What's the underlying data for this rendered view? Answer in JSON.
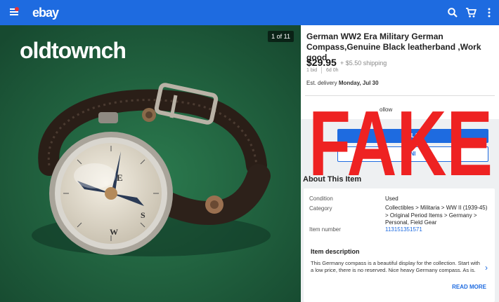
{
  "appbar": {
    "logo": "ebay",
    "icons": [
      "menu-icon",
      "search-icon",
      "cart-icon",
      "more-vert-icon"
    ],
    "brand_color": "#1e6be0",
    "notification_color": "#e53238"
  },
  "gallery": {
    "counter": "1 of 11",
    "watermark": "oldtownch",
    "compass_dial": [
      "E",
      "S",
      "W"
    ]
  },
  "listing": {
    "title": "German WW2 Era Military German Compass,Genuine Black leatherband ,Work good",
    "price": "$29.95",
    "shipping": "+ $5.50 shipping",
    "bids": "1 bid",
    "time_left": "6d 0h",
    "delivery_label": "Est. delivery",
    "delivery_date": "Monday, Jul 30",
    "follow_text": "ollow",
    "buy_button": "PLA",
    "offer_button": "NI"
  },
  "about": {
    "title": "About This Item",
    "rows": [
      {
        "label": "Condition",
        "value": "Used"
      },
      {
        "label": "Category",
        "value": "Collectibles > Militaria > WW II (1939-45) > Original Period Items > Germany > Personal, Field Gear"
      },
      {
        "label": "Item number",
        "value": "113151351571"
      }
    ]
  },
  "description": {
    "title": "Item description",
    "text": "This Germany compass is a beautiful display for the collection. Start with a low price, there is no reserved. Nice heavy Germany compass. As is.",
    "read_more": "READ MORE"
  },
  "overlay": {
    "text": "FAKE",
    "color": "#ee2222"
  }
}
